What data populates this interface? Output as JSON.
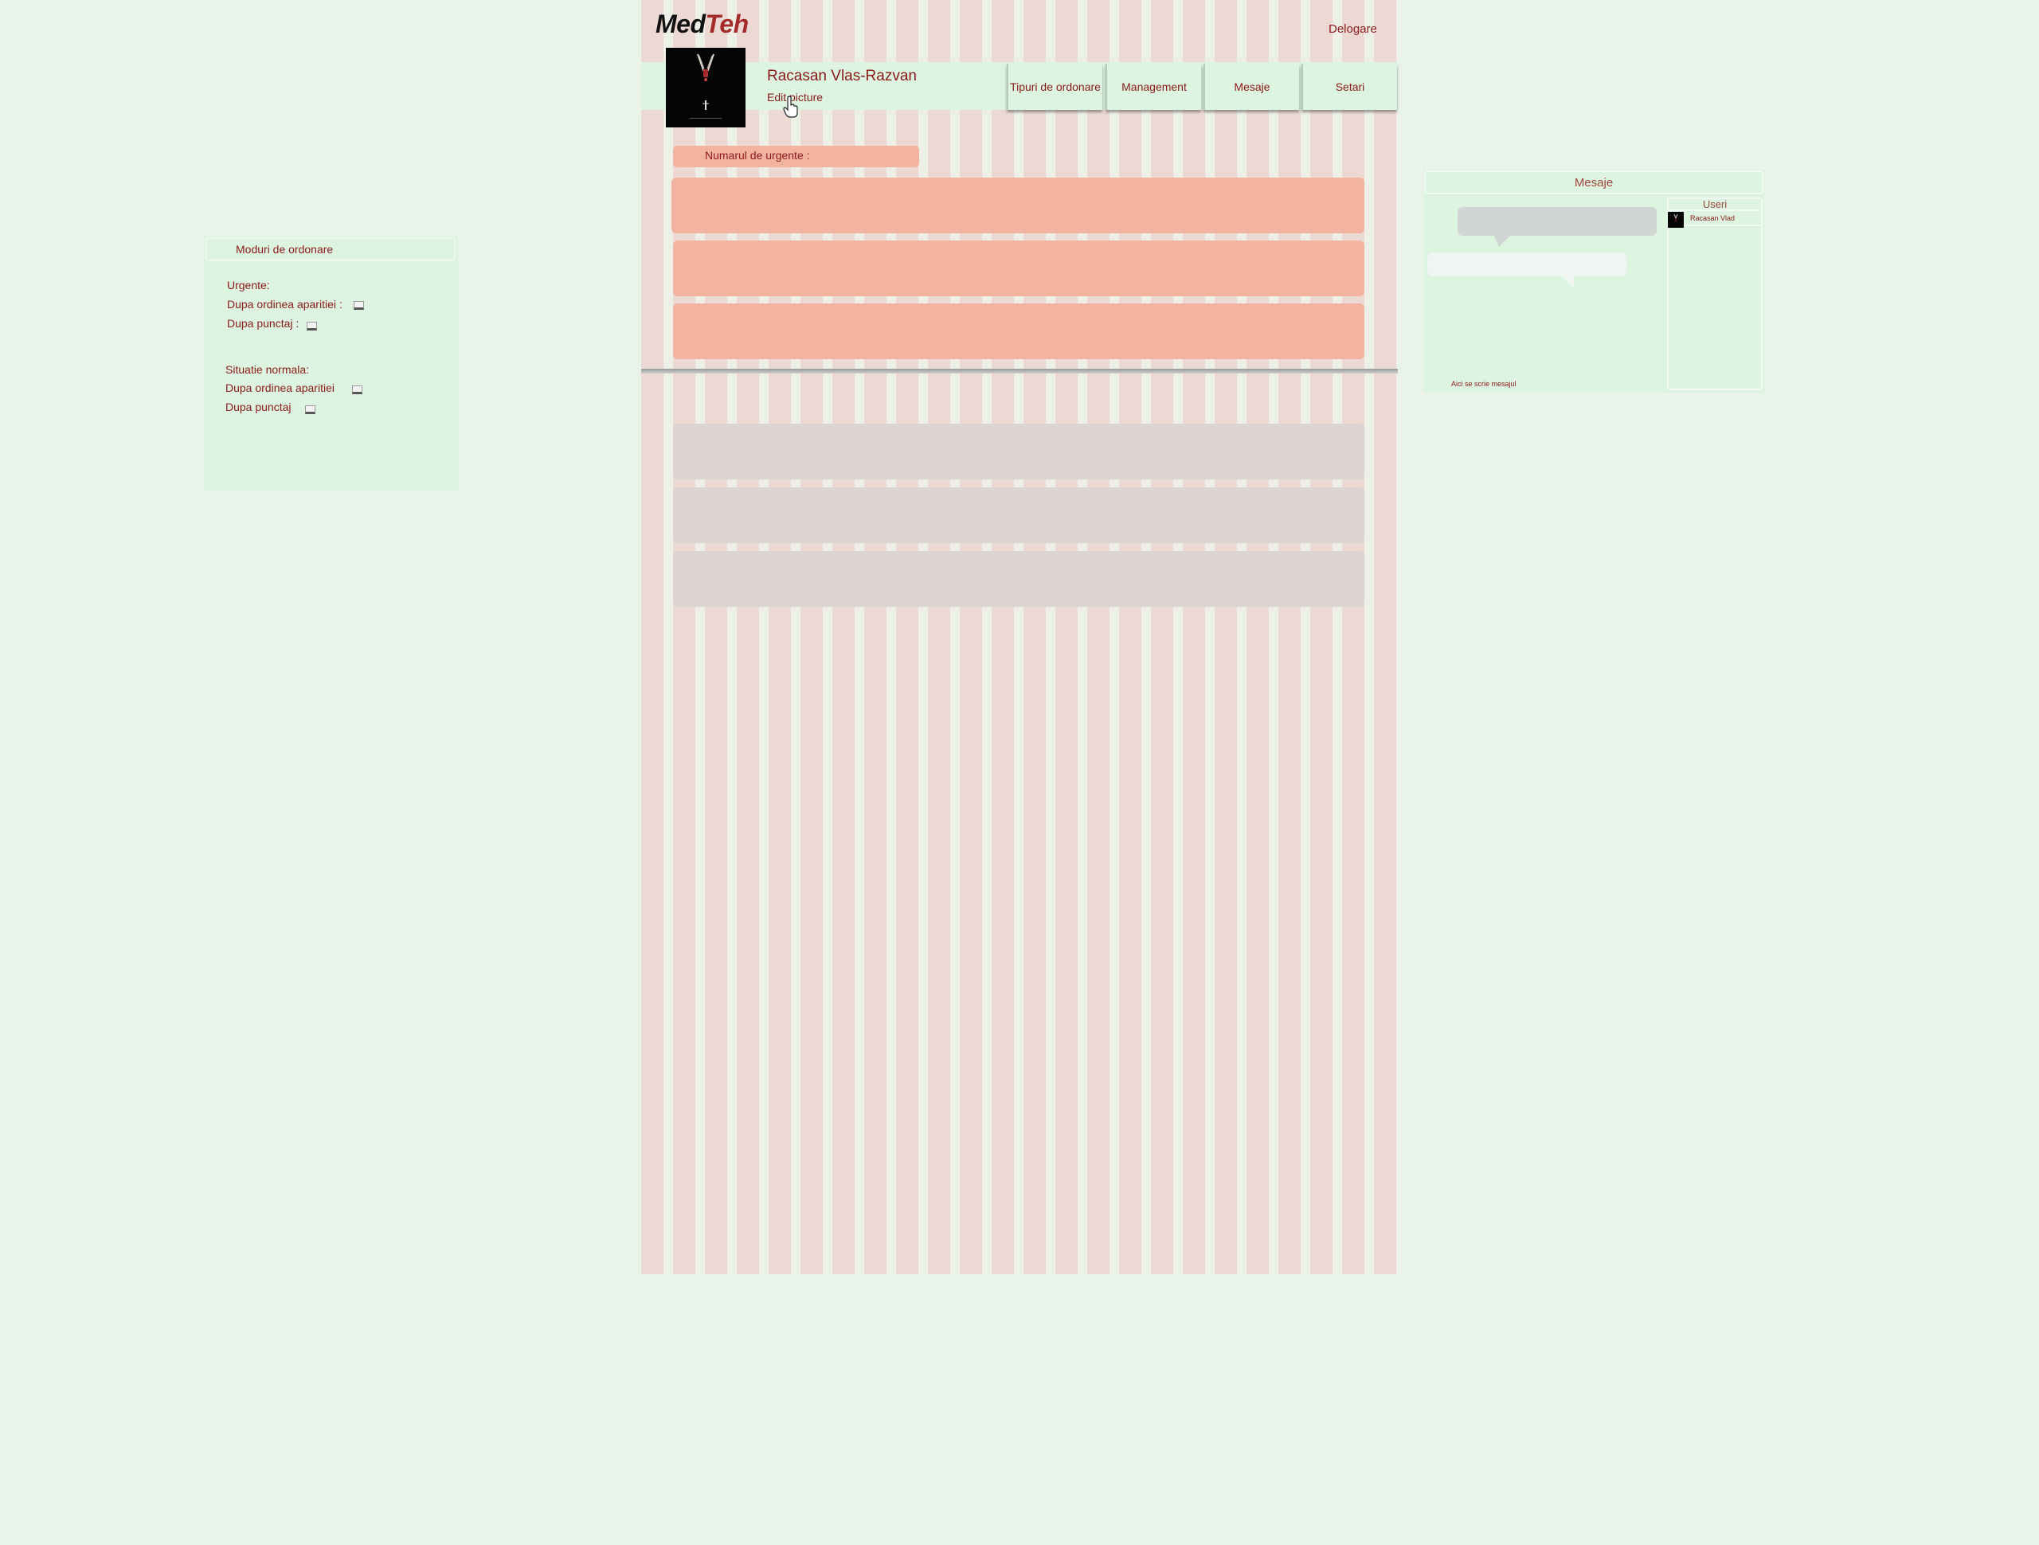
{
  "brand": {
    "part1": "Med",
    "part2": "Teh"
  },
  "header": {
    "logout_label": "Delogare",
    "user_name": "Racasan Vlas-Razvan",
    "edit_picture_label": "Edit picture",
    "nav": [
      {
        "label": "Tipuri de ordonare"
      },
      {
        "label": "Management"
      },
      {
        "label": "Mesaje"
      },
      {
        "label": "Setari"
      }
    ]
  },
  "urgent": {
    "count_label": "Numarul de urgente :",
    "cards": 3
  },
  "normal": {
    "cards": 3
  },
  "sort_panel": {
    "title": "Moduri de ordonare",
    "urgent_heading": "Urgente:",
    "urgent_by_order": "Dupa ordinea aparitiei :",
    "urgent_by_score": "Dupa punctaj :",
    "normal_heading": "Situatie normala:",
    "normal_by_order": "Dupa ordinea aparitiei",
    "normal_by_score": "Dupa punctaj"
  },
  "messages": {
    "title": "Mesaje",
    "users_heading": "Useri",
    "users": [
      {
        "name": "Racasan Vlad"
      }
    ],
    "input_placeholder": "Aici se scrie mesajul"
  },
  "colors": {
    "accent_text": "#8b1a1a",
    "urgent_card": "#f2b3a1",
    "normal_card": "#dcd4d2",
    "panel_bg": "#dcf4e0",
    "page_bg": "#e9f3ea"
  }
}
